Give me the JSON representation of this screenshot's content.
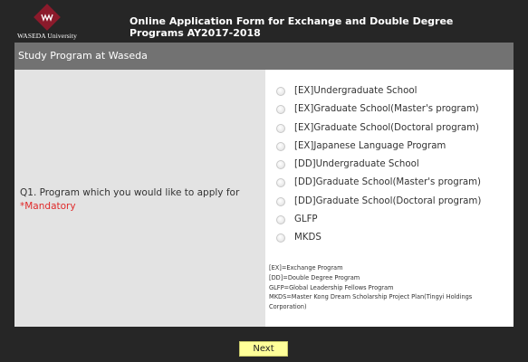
{
  "header": {
    "logo_text": "WASEDA University",
    "title": "Online Application Form for Exchange and Double Degree Programs AY2017-2018"
  },
  "section": {
    "title": "Study Program at Waseda"
  },
  "question": {
    "label": "Q1. Program which you would like to apply for",
    "mandatory": "*Mandatory"
  },
  "options": [
    {
      "label": "[EX]Undergraduate School",
      "selected": false
    },
    {
      "label": "[EX]Graduate School(Master's program)",
      "selected": false
    },
    {
      "label": "[EX]Graduate School(Doctoral program)",
      "selected": false
    },
    {
      "label": "[EX]Japanese Language Program",
      "selected": false
    },
    {
      "label": "[DD]Undergraduate School",
      "selected": false
    },
    {
      "label": "[DD]Graduate School(Master's program)",
      "selected": false
    },
    {
      "label": "[DD]Graduate School(Doctoral program)",
      "selected": false
    },
    {
      "label": "GLFP",
      "selected": false
    },
    {
      "label": "MKDS",
      "selected": false
    }
  ],
  "legend": [
    "[EX]=Exchange Program",
    "[DD]=Double Degree Program",
    "GLFP=Global Leadership Fellows Program",
    "MKDS=Master Kong Dream Scholarship Project Plan(Tingyi Holdings Corporation)"
  ],
  "footer": {
    "next_label": "Next"
  },
  "colors": {
    "background": "#262626",
    "section_bar": "#727272",
    "question_cell": "#e3e3e3",
    "mandatory": "#e02a2a",
    "next_button": "#ffff99",
    "logo": "#8b1a2b"
  }
}
